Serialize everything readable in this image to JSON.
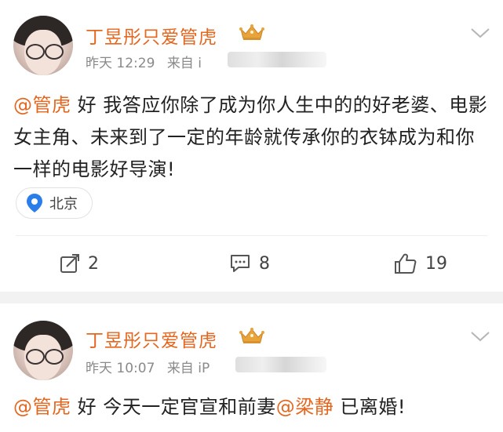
{
  "posts": [
    {
      "username": "丁昱彤只爱管虎",
      "badge_icon": "crown-icon",
      "time": "昨天 12:29",
      "source_prefix": "来自 i",
      "content_mention": "@管虎",
      "content_text": " 好 我答应你除了成为你人生中的的好老婆、电影女主角、未来到了一定的年龄就传承你的衣钵成为和你一样的电影好导演!",
      "location": "北京",
      "reposts": "2",
      "comments": "8",
      "likes": "19"
    },
    {
      "username": "丁昱彤只爱管虎",
      "badge_icon": "crown-icon",
      "time": "昨天 10:07",
      "source_prefix": "来自 iP",
      "content_mention1": "@管虎",
      "content_mid": " 好 今天一定官宣和前妻",
      "content_mention2": "@梁静",
      "content_end": " 已离婚!"
    }
  ],
  "colors": {
    "accent": "#e4661f",
    "text": "#222222",
    "meta": "#8a8a8a",
    "location_pin": "#2b7de9"
  }
}
